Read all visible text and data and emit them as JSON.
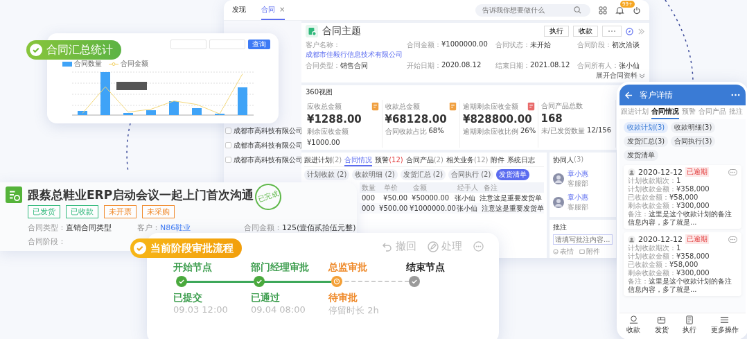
{
  "desktop": {
    "nav_tabs": [
      {
        "label": "发现",
        "selected": false
      },
      {
        "label": "合同",
        "selected": true,
        "close": "×"
      }
    ],
    "search": {
      "placeholder": "告诉我你想要做什么"
    },
    "notification_badge": "99+",
    "list": [
      {
        "name": "成都市高科技有限公司",
        "checked": false
      },
      {
        "name": "成都市高科技有限公司",
        "checked": false
      },
      {
        "name": "成都市高科技有限公司",
        "checked": false
      }
    ],
    "contract": {
      "title": "合同主题",
      "buttons": [
        "执行",
        "收款"
      ],
      "expand": "展开合同资料",
      "fields": [
        {
          "label": "客户名称：",
          "value": "成都市佳毅行信息技术有限公司",
          "kind": "link"
        },
        {
          "label": "合同金额：",
          "value": "¥1000000.00",
          "kind": "text"
        },
        {
          "label": "合同状态：",
          "value": "未开始",
          "kind": "text"
        },
        {
          "label": "合同阶段：",
          "value": "初次洽谈",
          "kind": "text"
        },
        {
          "label": "合同类型：",
          "value": "销售合同",
          "kind": "text"
        },
        {
          "label": "开始日期：",
          "value": "2020.08.12",
          "kind": "text"
        },
        {
          "label": "结束日期：",
          "value": "2021.08.12",
          "kind": "text"
        },
        {
          "label": "合同所有人：",
          "value": "张小仙",
          "kind": "text"
        }
      ]
    },
    "overview": {
      "title": "360视图",
      "stats": [
        {
          "label": "应收总金额",
          "value": "¥1288.00",
          "sub_label": "剩余应收金额",
          "sub_value": "¥1000.00",
          "color": "#f0a040"
        },
        {
          "label": "收款总金额",
          "value": "¥68128.00",
          "sub_label": "合同收款占比",
          "sub_value": "68%",
          "color": "#f0a040"
        },
        {
          "label": "逾期剩余应收金额",
          "value": "¥828800.00",
          "sub_label": "逾期剩余应收比例",
          "sub_value": "26%",
          "color": "#e86a6a"
        },
        {
          "label": "合同产品总数",
          "value": "168",
          "sub_label": "未/已发货数量",
          "sub_value": "12/156"
        }
      ]
    },
    "detail_tabs": [
      {
        "label": "跟进计划",
        "count": "(2)",
        "selected": false,
        "alert": false
      },
      {
        "label": "合同情况",
        "selected": true
      },
      {
        "label": "预警",
        "count": "(12)",
        "selected": false,
        "alert": true
      },
      {
        "label": "合同产品",
        "count": "(2)",
        "selected": false,
        "alert": false
      },
      {
        "label": "相关业务",
        "count": "(12)",
        "selected": false,
        "alert": false
      },
      {
        "label": "附件",
        "selected": false
      },
      {
        "label": "系统日志",
        "selected": false
      }
    ],
    "sub_tabs": [
      {
        "label": "计划收款 (2)",
        "selected": false
      },
      {
        "label": "收款明细 (2)",
        "selected": false
      },
      {
        "label": "发货汇总 (2)",
        "selected": false
      },
      {
        "label": "合同执行 (2)",
        "selected": false
      },
      {
        "label": "发货清单",
        "selected": true
      }
    ],
    "table": {
      "columns": [
        "数量",
        "单价",
        "金额",
        "经手人",
        "备注"
      ],
      "rows": [
        [
          "000",
          "¥50.00",
          "¥50000.00",
          "张小仙",
          "注意这是重要发货单"
        ],
        [
          "000",
          "¥500.00",
          "¥1000000.00",
          "张小仙",
          "注意这是重要发货单"
        ]
      ]
    },
    "collaborators": {
      "title": "协同人",
      "count": "(3)",
      "people": [
        {
          "name": "章小惠",
          "dept": "客服部"
        },
        {
          "name": "章小惠",
          "dept": "客服部"
        }
      ]
    },
    "comment": {
      "title": "批注",
      "placeholder": "请填写批注内容...",
      "actions": [
        {
          "label": "表情",
          "kind": "emoji"
        },
        {
          "label": "附件",
          "kind": "attach"
        }
      ]
    }
  },
  "stats_card": {
    "badge": "合同汇总统计",
    "query_button": "查询",
    "legend": [
      {
        "label": "合同数量",
        "kind": "bar"
      },
      {
        "label": "合同金额",
        "kind": "line"
      }
    ]
  },
  "task_card": {
    "title": "跟蔡总鞋业ERP启动会议一起上门首次沟通",
    "stamp": "已完成",
    "tags": [
      {
        "label": "已发货",
        "color": "#2fb87a"
      },
      {
        "label": "已收款",
        "color": "#2fb87a"
      },
      {
        "label": "未开票",
        "color": "#f08a2c"
      },
      {
        "label": "未采购",
        "color": "#f08a2c"
      }
    ],
    "fields": [
      {
        "label": "合同类型：",
        "value": "直销合同类型",
        "kind": "text"
      },
      {
        "label": "客户：",
        "value": "N86鞋业",
        "kind": "link"
      },
      {
        "label": "合同金额：",
        "value": "125(壹佰贰拾伍元整)",
        "kind": "text"
      },
      {
        "label": "合同阶段："
      }
    ]
  },
  "approval": {
    "badge": "当前阶段审批流程",
    "actions": [
      {
        "label": "撤回",
        "kind": "undo"
      },
      {
        "label": "处理",
        "kind": "edit"
      }
    ],
    "steps": [
      {
        "name": "开始节点",
        "status": "已提交",
        "time": "09.03 12:00",
        "completed": true,
        "current": false
      },
      {
        "name": "部门经理审批",
        "status": "已通过",
        "time": "09.04 08:00",
        "completed": true,
        "current": false
      },
      {
        "name": "总监审批",
        "status": "待审批",
        "time": "停留时长 2h",
        "completed": false,
        "current": true
      },
      {
        "name": "结束节点",
        "completed": false,
        "current": false
      }
    ]
  },
  "mobile": {
    "title": "客户详情",
    "tabs": [
      {
        "label": "跟进计划",
        "selected": false
      },
      {
        "label": "合同情况",
        "selected": true
      },
      {
        "label": "预警",
        "selected": false
      },
      {
        "label": "合同产品",
        "selected": false
      },
      {
        "label": "批注",
        "selected": false
      }
    ],
    "chips": [
      {
        "label": "收款计划(3)",
        "selected": true
      },
      {
        "label": "收款明细(3)",
        "selected": false
      },
      {
        "label": "发货汇总(3)",
        "selected": false
      },
      {
        "label": "合同执行(3)",
        "selected": false
      },
      {
        "label": "发货清单",
        "selected": false
      }
    ],
    "cards": [
      {
        "date": "2020-12-12",
        "tag": "已逾期",
        "lines": [
          {
            "label": "计划收款期次：",
            "value": "1"
          },
          {
            "label": "计划收款金额：",
            "value": "¥358,000"
          },
          {
            "label": "已收款金额：",
            "value": "¥58,000"
          },
          {
            "label": "剩余收款金额：",
            "value": "¥300,000"
          },
          {
            "label": "备注：",
            "value": "这里是这个收款计划的备注信息内容，多了就是..."
          }
        ]
      },
      {
        "date": "2020-12-12",
        "tag": "已逾期",
        "lines": [
          {
            "label": "计划收款期次：",
            "value": "1"
          },
          {
            "label": "计划收款金额：",
            "value": "¥358,000"
          },
          {
            "label": "已收款金额：",
            "value": "¥58,000"
          },
          {
            "label": "剩余收款金额：",
            "value": "¥300,000"
          },
          {
            "label": "备注：",
            "value": "这里是这个收款计划的备注信息内容，多了就是..."
          }
        ]
      }
    ],
    "nav": [
      {
        "label": "收款",
        "kind": "receive"
      },
      {
        "label": "发货",
        "kind": "ship"
      },
      {
        "label": "执行",
        "kind": "execute"
      },
      {
        "label": "更多操作",
        "kind": "more"
      }
    ]
  }
}
